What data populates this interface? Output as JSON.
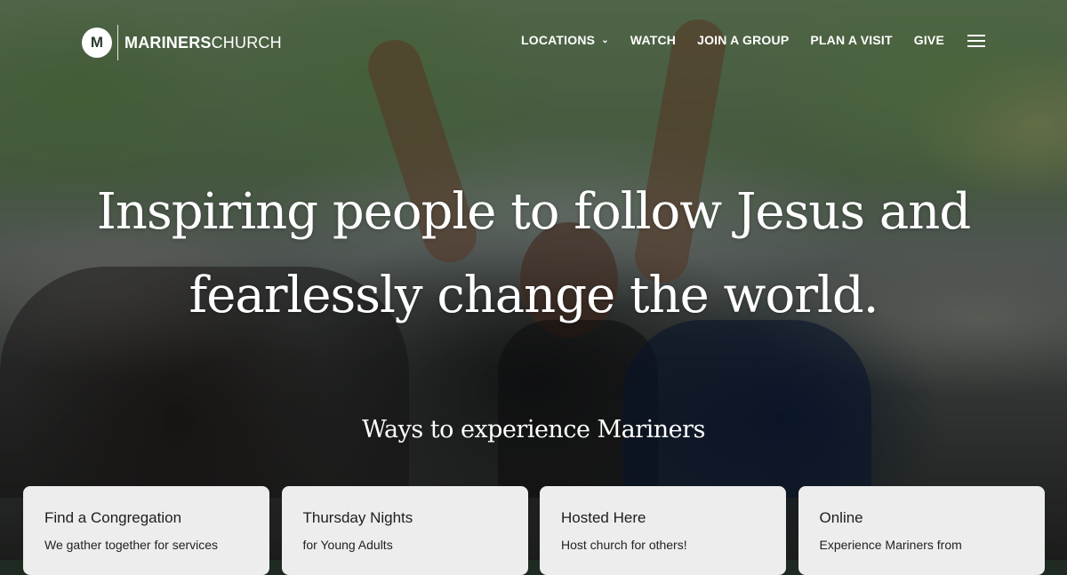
{
  "brand": {
    "logo_glyph": "M",
    "name_bold": "MARINERS",
    "name_light": "CHURCH"
  },
  "nav": {
    "items": [
      {
        "label": "LOCATIONS",
        "has_dropdown": true
      },
      {
        "label": "WATCH"
      },
      {
        "label": "JOIN A GROUP"
      },
      {
        "label": "PLAN A VISIT"
      },
      {
        "label": "GIVE"
      }
    ],
    "menu_icon": "hamburger-menu-icon"
  },
  "hero": {
    "headline_line1": "Inspiring people to follow Jesus and",
    "headline_line2": "fearlessly change the world.",
    "subheading": "Ways to experience Mariners"
  },
  "cards": [
    {
      "title": "Find a Congregation",
      "description": "We gather together for services"
    },
    {
      "title": "Thursday Nights",
      "description": "for Young Adults"
    },
    {
      "title": "Hosted Here",
      "description": "Host church for others!"
    },
    {
      "title": "Online",
      "description": "Experience Mariners from"
    }
  ],
  "colors": {
    "text": "#ffffff",
    "card_bg": "#ededed",
    "card_text": "#1d1d1d"
  }
}
